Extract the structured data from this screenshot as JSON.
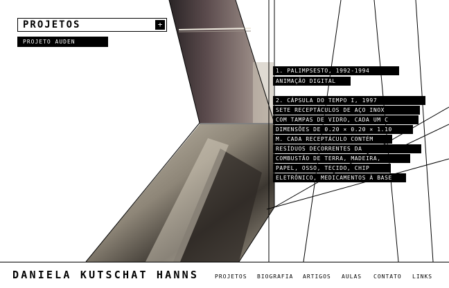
{
  "header": {
    "section_title": "PROJETOS",
    "expand_symbol": "+",
    "selected_project": "PROJETO AUDEN"
  },
  "description": {
    "lines": [
      "1. PALIMPSESTO, 1992-1994",
      "ANIMAÇÃO DIGITAL",
      "2. CÁPSULA DO TEMPO I, 1997",
      "SETE RECEPTÁCULOS DE AÇO INOX",
      "COM TAMPAS DE VIDRO, CADA UM C",
      "DIMENSÕES DE 0.20 × 0.20 × 1.10",
      "M. CADA RECEPTÁCULO CONTÉM",
      "RESÍDUOS DECORRENTES DA",
      "COMBUSTÃO DE TERRA, MADEIRA,",
      "PAPEL, OSSO, TECIDO, CHIP",
      "ELETRÔNICO, MEDICAMENTOS À BASE"
    ]
  },
  "footer": {
    "brand": "DANIELA KUTSCHAT HANNS",
    "nav": [
      "PROJETOS",
      "BIOGRAFIA",
      "ARTIGOS",
      "AULAS",
      "CONTATO",
      "LINKS"
    ]
  },
  "colors": {
    "background": "#ffffff",
    "ink": "#000000"
  }
}
